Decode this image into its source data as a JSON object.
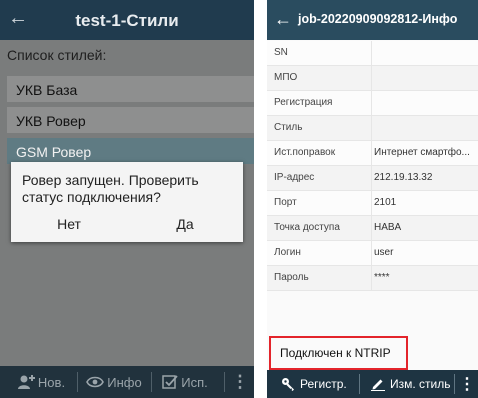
{
  "left_screen": {
    "title": "test-1-Стили",
    "back_icon": "←",
    "list_label": "Список стилей:",
    "items": [
      {
        "label": "УКВ База"
      },
      {
        "label": "УКВ Ровер"
      },
      {
        "label": "GSM Ровер",
        "selected": true
      }
    ],
    "dialog": {
      "message": "Ровер запущен. Проверить статус подключения?",
      "no_label": "Нет",
      "yes_label": "Да"
    },
    "toolbar": {
      "new_label": "Нов.",
      "info_label": "Инфо",
      "use_label": "Исп.",
      "more_icon": "⋮"
    }
  },
  "right_screen": {
    "title": "job-20220909092812-Инфо",
    "back_icon": "←",
    "rows": [
      {
        "key": "SN",
        "value": ""
      },
      {
        "key": "МПО",
        "value": ""
      },
      {
        "key": "Регистрация",
        "value": ""
      },
      {
        "key": "Стиль",
        "value": ""
      },
      {
        "key": "Ист.поправок",
        "value": "Интернет смартфо..."
      },
      {
        "key": "IP-адрес",
        "value": "212.19.13.32"
      },
      {
        "key": "Порт",
        "value": "2101"
      },
      {
        "key": "Точка доступа",
        "value": "HABA"
      },
      {
        "key": "Логин",
        "value": "user"
      },
      {
        "key": "Пароль",
        "value": "****"
      }
    ],
    "status": "Подключен к NTRIP",
    "toolbar": {
      "register_label": "Регистр.",
      "edit_style_label": "Изм. стиль",
      "more_icon": "⋮"
    }
  },
  "colors": {
    "appbar_left": "#203b4e",
    "appbar_right": "#2a4c5f",
    "bottom_bar": "#1e3442",
    "selected_item": "#5f7b83",
    "status_border": "#e3242b"
  }
}
